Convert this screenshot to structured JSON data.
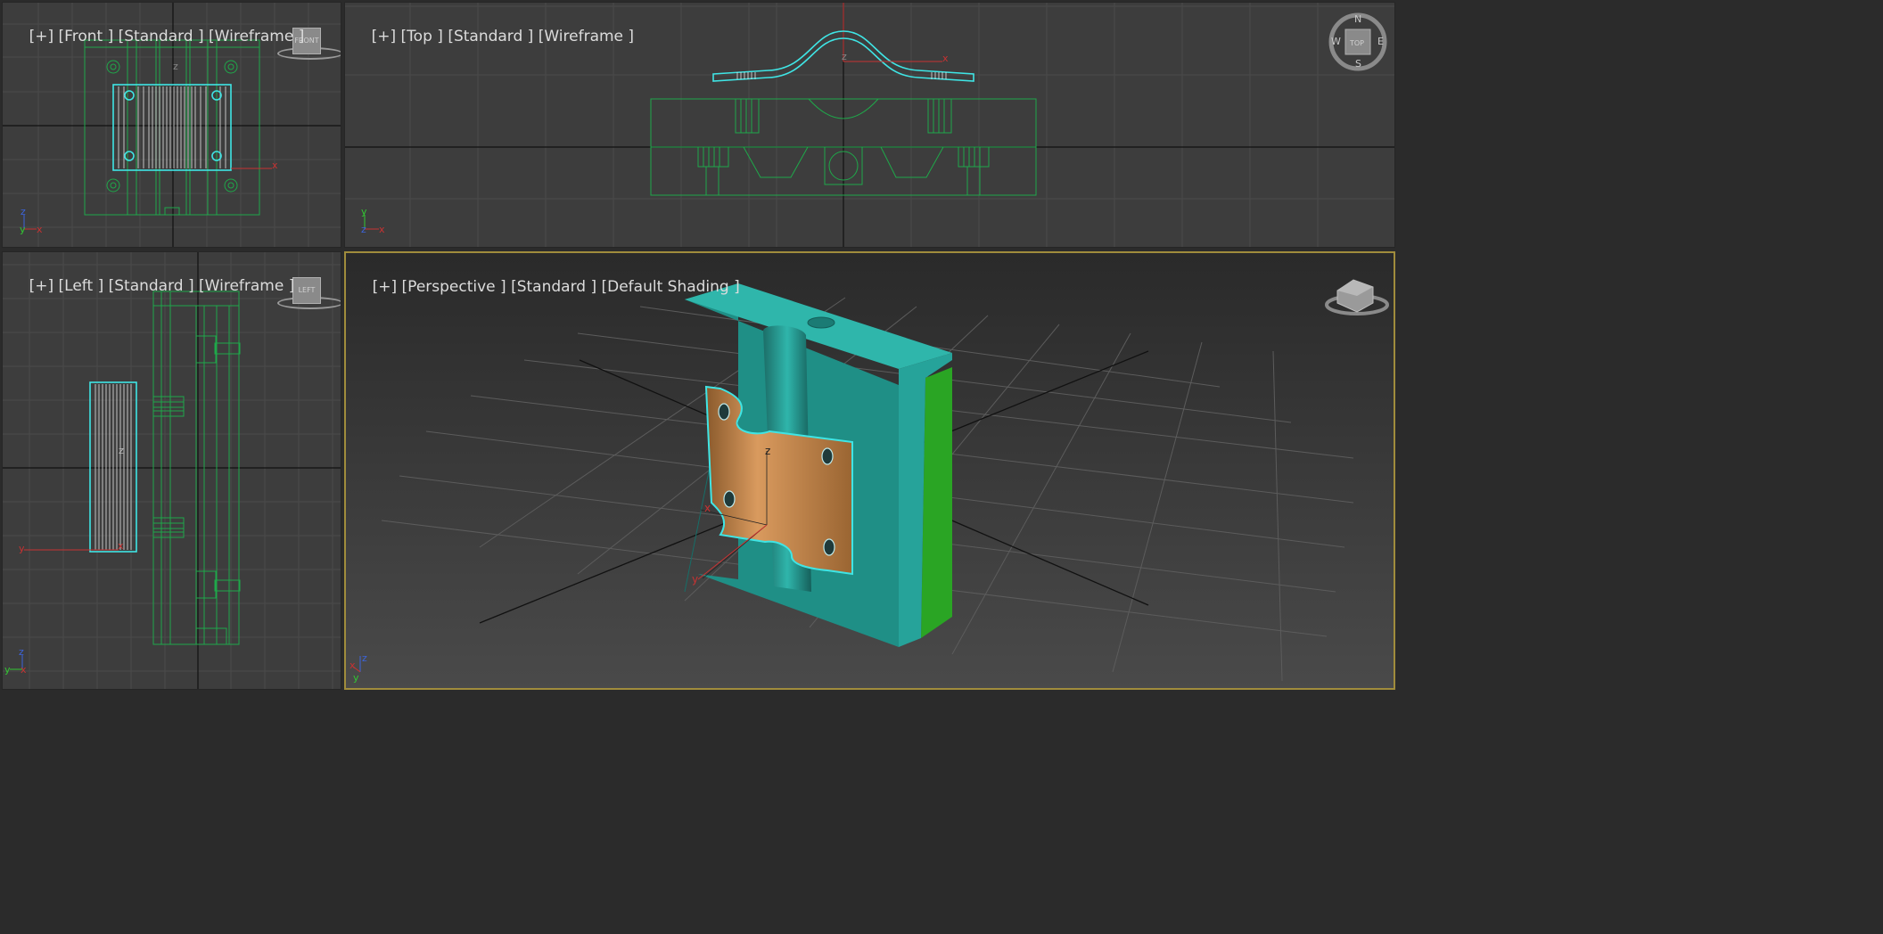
{
  "viewports": {
    "front": {
      "plus": "[+]",
      "view": "[Front ]",
      "mode": "[Standard ]",
      "shading": "[Wireframe ]",
      "cube_label": "FRONT"
    },
    "top": {
      "plus": "[+]",
      "view": "[Top ]",
      "mode": "[Standard ]",
      "shading": "[Wireframe ]",
      "cube_label": "TOP"
    },
    "left": {
      "plus": "[+]",
      "view": "[Left ]",
      "mode": "[Standard ]",
      "shading": "[Wireframe ]",
      "cube_label": "LEFT"
    },
    "perspective": {
      "plus": "[+]",
      "view": "[Perspective ]",
      "mode": "[Standard ]",
      "shading": "[Default Shading ]"
    }
  },
  "compass": {
    "n": "N",
    "s": "S",
    "e": "E",
    "w": "W"
  },
  "axes": {
    "x": "x",
    "y": "y",
    "z": "z"
  },
  "colors": {
    "viewport_bg": "#3d3d3d",
    "wire_green": "#1fa84a",
    "selected_cyan": "#3fe5e5",
    "mold_teal": "#25aaa0",
    "part_copper": "#c88a4e",
    "active_border": "#a08c3c",
    "axis_red": "#c83232",
    "axis_blue": "#3c64dc",
    "axis_green": "#32c832"
  },
  "icons": [
    "view-cube-icon",
    "compass-icon",
    "axis-tripod-icon"
  ]
}
